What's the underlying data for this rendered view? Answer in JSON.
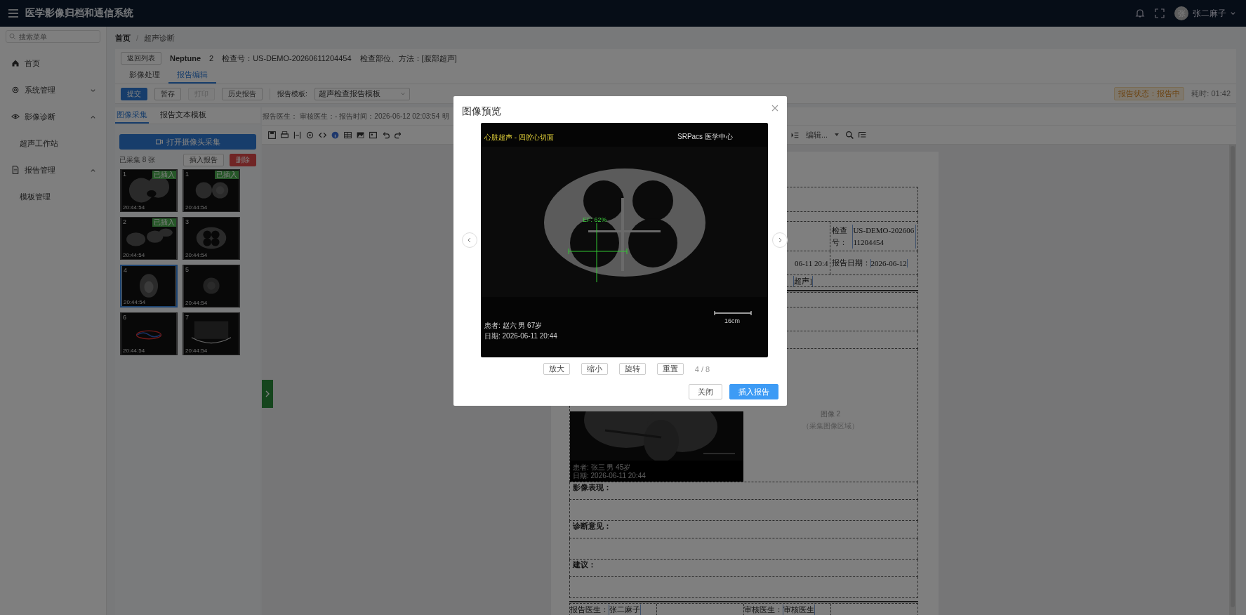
{
  "app": {
    "title": "医学影像归档和通信系统",
    "avatar": "张",
    "user": "张二麻子"
  },
  "sidebar": {
    "search_placeholder": "搜索菜单",
    "items": [
      {
        "label": "首页"
      },
      {
        "label": "系统管理",
        "expanded": false
      },
      {
        "label": "影像诊断",
        "expanded": true,
        "children": [
          {
            "label": "超声工作站"
          }
        ]
      },
      {
        "label": "报告管理",
        "expanded": true,
        "children": [
          {
            "label": "模板管理"
          }
        ]
      }
    ]
  },
  "breadcrumb": [
    "首页",
    "超声诊断"
  ],
  "breadcrumb_separator": "/",
  "exam": {
    "back": "返回列表",
    "patient": "Neptune",
    "count": "2",
    "exam_no": "检查号：US-DEMO-20260611204454",
    "exam_part": "检查部位、方法：[腹部超声]"
  },
  "tabs": [
    {
      "label": "影像处理",
      "selected": false
    },
    {
      "label": "报告编辑",
      "selected": true
    }
  ],
  "toolbar": {
    "buttons": [
      {
        "label": "提交",
        "kind": "primary",
        "disabled": false
      },
      {
        "label": "暂存",
        "kind": "default",
        "disabled": false
      },
      {
        "label": "打印",
        "kind": "default",
        "disabled": true
      },
      {
        "label": "历史报告",
        "kind": "default",
        "disabled": false
      }
    ],
    "template_label": "报告模板:",
    "template_value": "超声检查报告模板",
    "status": "报告状态：报告中",
    "elapsed": "耗时: 01:42"
  },
  "capture": {
    "tabs": [
      {
        "label": "图像采集",
        "selected": true
      },
      {
        "label": "报告文本模板",
        "selected": false
      }
    ],
    "camera_button": "打开摄像头采集",
    "count": "已采集 8 张",
    "insert": "插入报告",
    "delete": "删除",
    "thumbnails": [
      {
        "number": "1",
        "time": "20:44:54",
        "badge": "已插入",
        "selected": false
      },
      {
        "number": "1",
        "time": "20:44:54",
        "badge": "已插入",
        "selected": false
      },
      {
        "number": "2",
        "time": "20:44:54",
        "badge": "已插入",
        "selected": false
      },
      {
        "number": "3",
        "time": "20:44:54",
        "selected": false
      },
      {
        "number": "4",
        "time": "20:44:54",
        "selected": true
      },
      {
        "number": "5",
        "time": "20:44:54",
        "selected": false
      },
      {
        "number": "6",
        "time": "20:44:54",
        "selected": false
      },
      {
        "number": "7",
        "time": "20:44:54",
        "selected": false
      }
    ]
  },
  "editor": {
    "meta": [
      "报告医生：",
      "审核医生：-",
      "报告时间：2026-06-12 02:03:54",
      "明"
    ],
    "style_select": "编辑..."
  },
  "document": {
    "exam_no_label": "检查号：",
    "exam_no": "US-DEMO-20260611204454",
    "exam_time_fragment": "06-11 20:4",
    "report_date_label": "报告日期：",
    "report_date": "2026-06-12",
    "part_fragment": "超声]",
    "image_caption": [
      "患者: 张三 男 45岁",
      "日期: 2026-06-11 20:44"
    ],
    "image_slot": {
      "title": "图像 2",
      "hint": "（采集图像区域）"
    },
    "sections": [
      "影像表现：",
      "诊断意见：",
      "建议："
    ],
    "signatures": [
      {
        "label": "报告医生：",
        "value": "张二麻子"
      },
      {
        "label": "审核医生：",
        "value": "审核医生"
      }
    ]
  },
  "modal": {
    "title": "图像预览",
    "image": {
      "title": "心脏超声 - 四腔心切面",
      "brand": "SRPacs 医学中心",
      "measure": "EF: 62%",
      "scale": "16cm",
      "patient": "患者: 赵六 男 67岁",
      "date": "日期: 2026-06-11 20:44"
    },
    "tools": [
      "放大",
      "缩小",
      "旋转",
      "重置"
    ],
    "counter": "4 / 8",
    "cancel": "关闭",
    "confirm": "插入报告"
  }
}
